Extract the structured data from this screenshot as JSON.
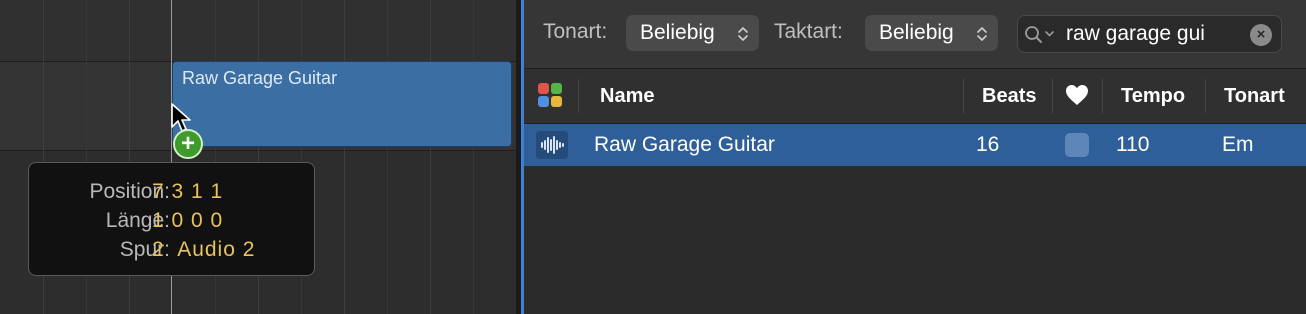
{
  "tracks": {
    "region": {
      "name": "Raw Garage Guitar"
    },
    "tooltip": {
      "rows": [
        {
          "label": "Position:",
          "value": "7 3 1 1"
        },
        {
          "label": "Länge:",
          "value": "1 0 0 0"
        },
        {
          "label": "Spur:",
          "value": "2  Audio 2"
        }
      ]
    },
    "add_badge": "+"
  },
  "browser": {
    "filters": {
      "key_label": "Tonart:",
      "key_value": "Beliebig",
      "signature_label": "Taktart:",
      "signature_value": "Beliebig"
    },
    "search": {
      "value": "raw garage gui",
      "clear": "×"
    },
    "columns": {
      "name": "Name",
      "beats": "Beats",
      "tempo": "Tempo",
      "key": "Tonart"
    },
    "rows": [
      {
        "name": "Raw Garage Guitar",
        "beats": "16",
        "favorite": false,
        "tempo": "110",
        "key": "Em"
      }
    ]
  },
  "colors": {
    "region": "#3b6ea3",
    "selected_row": "#2f5f98",
    "tooltip_value": "#e8c25e",
    "add_badge": "#3e9a2a",
    "divider_accent": "#3b82d6"
  },
  "icons": [
    "cursor-arrow-icon",
    "add-badge-icon",
    "chevron-updown-icon",
    "search-icon",
    "clear-icon",
    "loop-type-icon",
    "heart-icon",
    "waveform-icon"
  ]
}
